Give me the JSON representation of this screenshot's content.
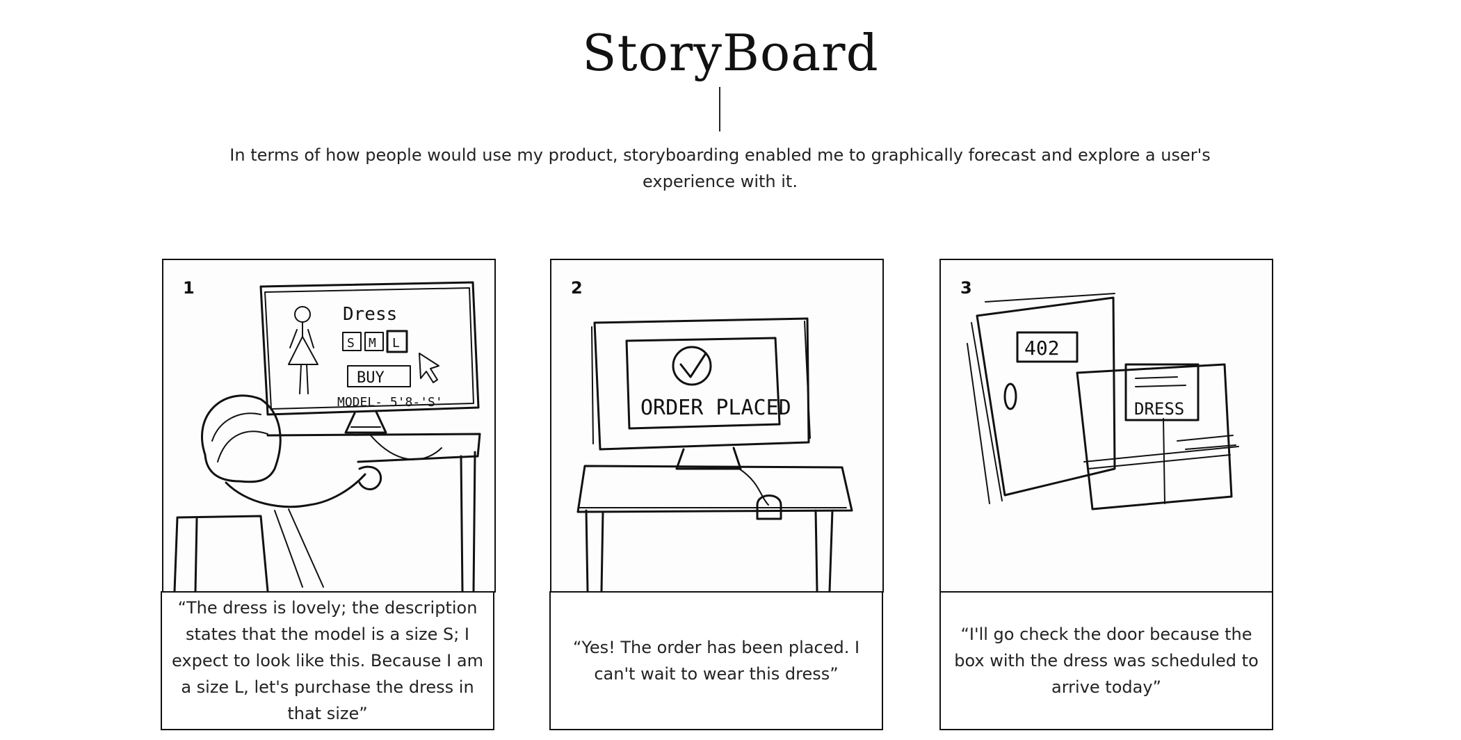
{
  "page": {
    "title": "StoryBoard",
    "intro": "In terms of how people would use my product, storyboarding enabled me to graphically forecast and explore a user's experience with it."
  },
  "panels": [
    {
      "number": "1",
      "caption": "“The dress is lovely; the description states that the model is a size S; I expect to look like this. Because I am a size L, let's purchase the dress in that size”",
      "sketch_text": {
        "dress": "Dress",
        "size_s": "S",
        "size_m": "M",
        "size_l": "L",
        "buy": "BUY",
        "model": "MODEL- 5'8-'S'"
      }
    },
    {
      "number": "2",
      "caption": "“Yes! The order has been placed. I can't wait to wear this dress”",
      "sketch_text": {
        "order": "ORDER PLACED"
      }
    },
    {
      "number": "3",
      "caption": "“I'll go check the door because the box with the dress was scheduled to arrive today”",
      "sketch_text": {
        "door_number": "402",
        "box_label": "DRESS"
      }
    }
  ]
}
